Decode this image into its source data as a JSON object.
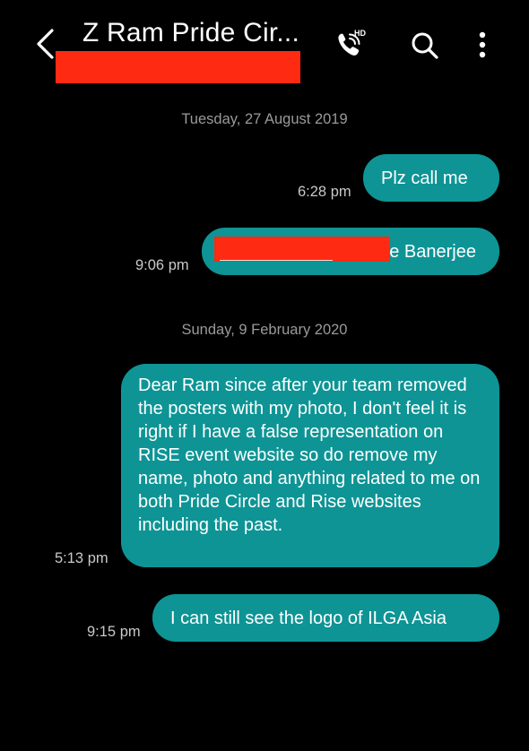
{
  "header": {
    "title": "Z Ram Pride Cir...",
    "hd_badge": "HD"
  },
  "messages": {
    "date1": "Tuesday, 27 August 2019",
    "msg1": {
      "text": "Plz call me",
      "time": "6:28 pm"
    },
    "msg2": {
      "text_visible": "e Banerjee",
      "time": "9:06 pm"
    },
    "date2": "Sunday, 9 February 2020",
    "msg3": {
      "text": "Dear Ram since after your team removed the posters with my photo, I don't feel it is right if I have a false representation on RISE event website so do remove my name, photo and anything related to me on both Pride Circle and Rise websites including the past.",
      "time": "5:13 pm"
    },
    "msg4": {
      "text": "I can still see the logo of ILGA Asia",
      "time": "9:15 pm"
    }
  },
  "colors": {
    "background": "#000000",
    "bubble": "#0e9495",
    "redaction": "#ff2a12",
    "timestamp": "#c9c9c9",
    "date_separator": "#9a9a9a"
  }
}
